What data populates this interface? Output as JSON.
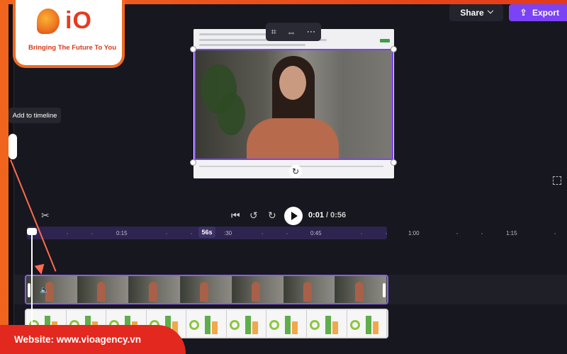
{
  "logo": {
    "mark": "iO",
    "tagline": "Bringing The Future To You"
  },
  "header": {
    "share_label": "Share",
    "export_label": "Export"
  },
  "tooltip": {
    "text": "Add to timeline"
  },
  "playback": {
    "current_time": "0:01",
    "separator": "/",
    "total_time": "0:56"
  },
  "ruler": {
    "ticks": [
      "0:15",
      ":30",
      "0:45",
      "1:00",
      "1:15"
    ],
    "duration_badge": "56s"
  },
  "banner": {
    "website": "Website: www.vioagency.vn"
  },
  "icons": {
    "share": "chevron-down-icon",
    "export": "upload-icon",
    "crop": "crop-icon",
    "fit": "fit-icon",
    "more": "more-icon",
    "rotate": "rotate-icon",
    "skip_back": "skip-back-icon",
    "rewind5": "rewind-5-icon",
    "forward5": "forward-5-icon",
    "play": "play-icon",
    "split": "scissors-icon",
    "mute": "volume-icon",
    "fullscreen": "fullscreen-icon"
  },
  "colors": {
    "accent": "#7b43f5",
    "brand": "#e23a1a",
    "background": "#17171f"
  }
}
